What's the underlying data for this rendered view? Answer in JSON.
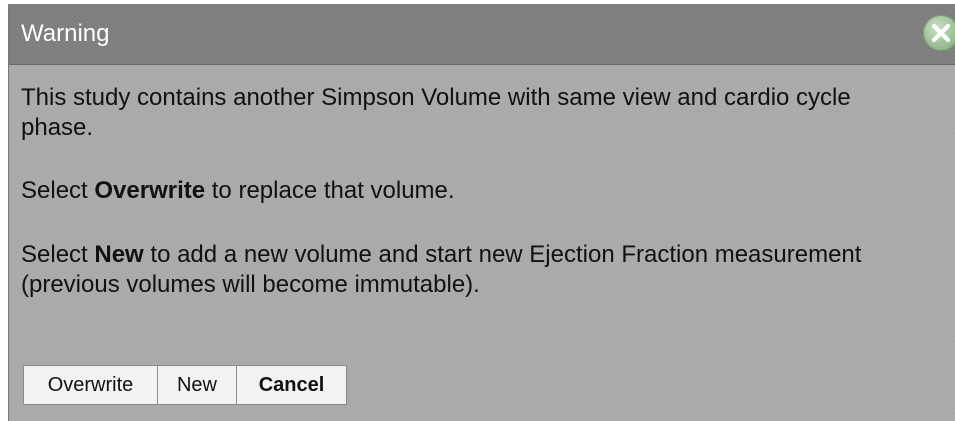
{
  "dialog": {
    "title": "Warning",
    "close_icon": "close-icon",
    "message": {
      "line1": "This study contains another Simpson Volume with same view and cardio cycle phase.",
      "line2_prefix": "Select ",
      "line2_bold": "Overwrite",
      "line2_suffix": " to replace that volume.",
      "line3_prefix": "Select ",
      "line3_bold": "New",
      "line3_suffix": " to add a new volume and start new Ejection Fraction measurement (previous volumes will become immutable)."
    },
    "buttons": {
      "overwrite": "Overwrite",
      "new": "New",
      "cancel": "Cancel"
    }
  },
  "colors": {
    "titlebar": "#7d7d7d",
    "body": "#a9a9a9",
    "close_icon": "#9ebf97"
  }
}
